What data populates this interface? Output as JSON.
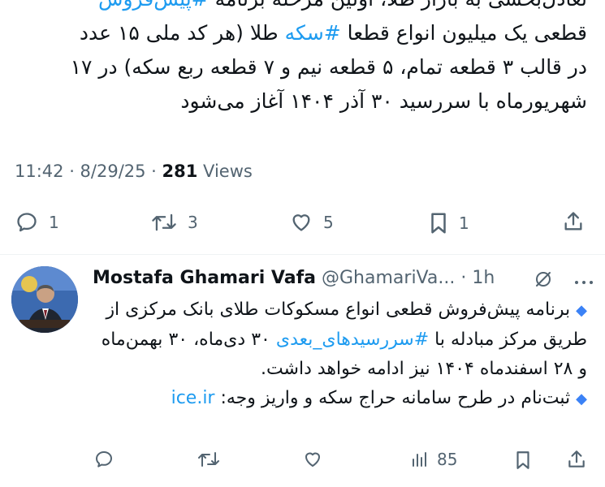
{
  "main_tweet": {
    "text_line0_a": "تعادل‌بخشی به بازار طلا، اولین مرحله برنامه ",
    "text_line0_tag": "#پیش‌فروش",
    "text_line1_a": "قطعی یک میلیون انواع قطعا ",
    "text_line1_tag": "#سکه",
    "text_line1_b": " طلا (هر کد ملی ۱۵ عدد",
    "text_line2": "در قالب ۳ قطعه تمام، ۵ قطعه نیم و ۷ قطعه ربع سکه) در ۱۷",
    "text_line3": "شهریورماه با سررسید ۳۰ آذر ۱۴۰۴ آغاز می‌شود",
    "time": "11:42 · 8/29/25 · ",
    "views_count": "281",
    "views_label": " Views",
    "replies": "1",
    "retweets": "3",
    "likes": "5",
    "bookmarks": "1"
  },
  "reply_tweet": {
    "author_name": "Mostafa Ghamari Vafa",
    "handle": " @GhamariVa...",
    "time": " · 1h",
    "para1_a": "برنامه پیش‌فروش قطعی انواع مسکوکات طلای بانک مرکزی از طریق مرکز مبادله با ",
    "para1_tag": "#سررسیدهای_بعدی",
    "para1_b": " ۳۰ دی‌ماه، ۳۰ بهمن‌ماه و ۲۸ اسفندماه ۱۴۰۴ نیز ادامه خواهد داشت.",
    "para2_a": "ثبت‌نام در طرح سامانه حراج سکه و واریز وجه: ",
    "para2_link": "ice.ir",
    "views": "85"
  },
  "icons": {
    "reply": "reply-icon",
    "retweet": "retweet-icon",
    "like": "heart-icon",
    "bookmark": "bookmark-icon",
    "share": "share-icon",
    "analytics": "analytics-icon",
    "grok": "grok-icon",
    "more": "more-icon"
  },
  "colors": {
    "accent": "#1d9bf0",
    "muted": "#536471",
    "text": "#0f1419"
  }
}
